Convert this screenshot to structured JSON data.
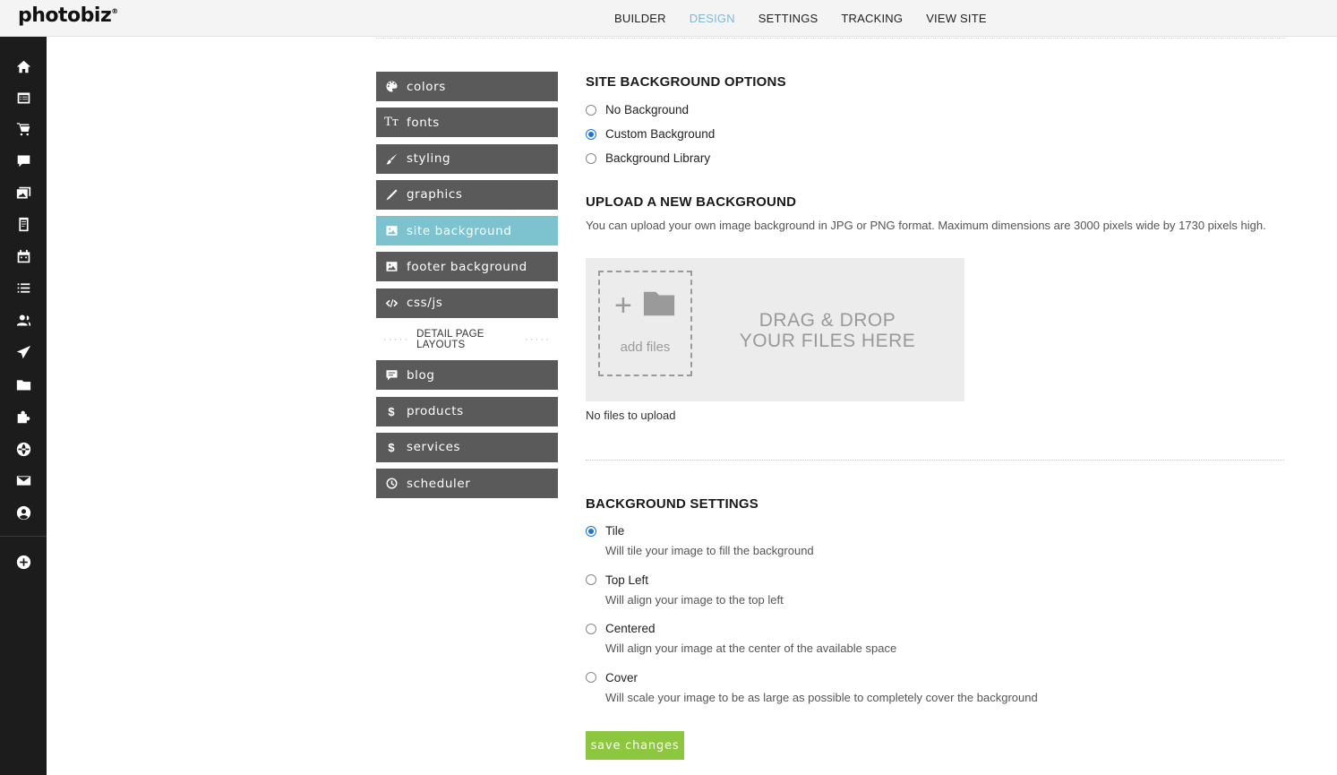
{
  "brand": {
    "name": "photobiz",
    "mark": "®"
  },
  "topnav": {
    "items": [
      {
        "label": "BUILDER"
      },
      {
        "label": "DESIGN",
        "active": true
      },
      {
        "label": "SETTINGS"
      },
      {
        "label": "TRACKING"
      },
      {
        "label": "VIEW SITE"
      }
    ]
  },
  "rail": {
    "icons": [
      "home-icon",
      "pages-icon",
      "cart-icon",
      "comment-icon",
      "gallery-icon",
      "document-icon",
      "calendar-icon",
      "list-icon",
      "users-icon",
      "send-icon",
      "folder-icon",
      "puzzle-icon",
      "globe-icon",
      "mail-icon",
      "account-icon",
      "add-icon"
    ]
  },
  "menu": {
    "items": [
      {
        "label": "colors",
        "icon": "palette-icon"
      },
      {
        "label": "fonts",
        "icon": "font-icon"
      },
      {
        "label": "styling",
        "icon": "brush-icon"
      },
      {
        "label": "graphics",
        "icon": "pencil-icon"
      },
      {
        "label": "site background",
        "icon": "image-icon",
        "active": true
      },
      {
        "label": "footer background",
        "icon": "image-icon"
      },
      {
        "label": "css/js",
        "icon": "code-icon"
      }
    ],
    "separator": "DETAIL PAGE LAYOUTS",
    "detail_items": [
      {
        "label": "blog",
        "icon": "comment-icon"
      },
      {
        "label": "products",
        "icon": "dollar-icon"
      },
      {
        "label": "services",
        "icon": "dollar-icon"
      },
      {
        "label": "scheduler",
        "icon": "clock-icon"
      }
    ]
  },
  "site_background": {
    "title": "SITE BACKGROUND OPTIONS",
    "options": [
      {
        "label": "No Background",
        "selected": false
      },
      {
        "label": "Custom Background",
        "selected": true
      },
      {
        "label": "Background Library",
        "selected": false
      }
    ]
  },
  "upload": {
    "title": "UPLOAD A NEW BACKGROUND",
    "description": "You can upload your own image background in JPG or PNG format. Maximum dimensions are 3000 pixels wide by 1730 pixels high.",
    "add_files_label": "add files",
    "drop_line1": "DRAG & DROP",
    "drop_line2": "YOUR FILES HERE",
    "status": "No files to upload"
  },
  "bg_settings": {
    "title": "BACKGROUND SETTINGS",
    "options": [
      {
        "label": "Tile",
        "description": "Will tile your image to fill the background",
        "selected": true
      },
      {
        "label": "Top Left",
        "description": "Will align your image to the top left",
        "selected": false
      },
      {
        "label": "Centered",
        "description": "Will align your image at the center of the available space",
        "selected": false
      },
      {
        "label": "Cover",
        "description": "Will scale your image to be as large as possible to completely cover the background",
        "selected": false
      }
    ]
  },
  "save_label": "save changes",
  "colors": {
    "accent_active": "#7cc3cf",
    "menu_bg": "#5a5a5a",
    "save_bg": "#8dc63f",
    "radio_on": "#1c74d8",
    "nav_active": "#7fb8d4"
  }
}
